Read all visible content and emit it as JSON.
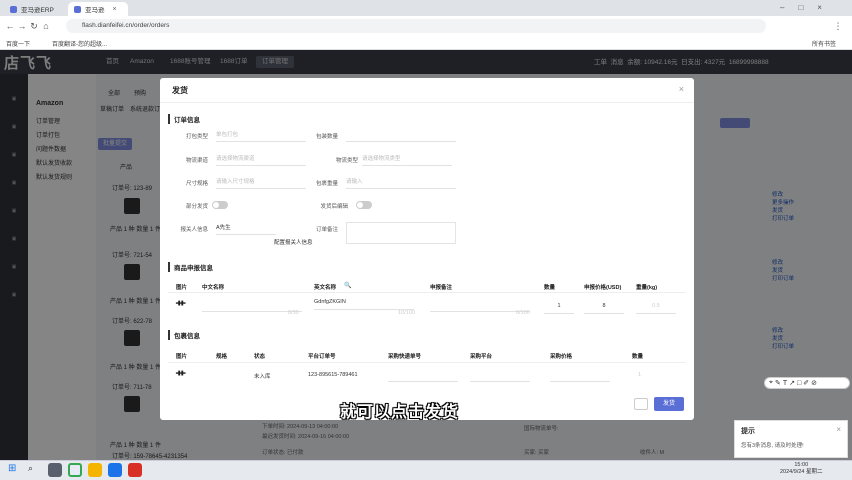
{
  "browser": {
    "tabs": [
      {
        "label": "亚马逊ERP",
        "active": false
      },
      {
        "label": "亚马逊",
        "active": true
      }
    ],
    "url": "flash.dianfeifei.cn/order/orders",
    "bookmarks": [
      "百度一下",
      "百度翻译-您的超级..."
    ],
    "bookmarks_right": "所有书签"
  },
  "app": {
    "logo": "店飞飞",
    "topnav": [
      "首页",
      "Amazon",
      "1688账号管理",
      "1688订单",
      "订单管理"
    ],
    "topnav_active": "订单管理",
    "right_info": {
      "work": "工单",
      "messages": "消息",
      "balance": "余额: 10942.16元",
      "cost": "日支出: 4327元",
      "phone": "16899998888"
    },
    "sidebar_heading": "Amazon",
    "sidebar_items": [
      "订单管理",
      "订单打包",
      "问题件数据",
      "默认发货收款",
      "默认发货规则"
    ]
  },
  "background": {
    "tabs": [
      "全部",
      "预购"
    ],
    "filters": [
      "草稿订单",
      "系统退款订单"
    ],
    "buttons": [
      "批量提交"
    ],
    "label_product": "产品",
    "orders": [
      {
        "no": "订单号: 123-89",
        "line": "产品 1 种  数量 1 件"
      },
      {
        "no": "订单号: 721-54",
        "line": "产品 1 种  数量 1 件"
      },
      {
        "no": "订单号: 622-78",
        "line": "产品 1 种  数量 1 件"
      },
      {
        "no": "订单号: 711-78",
        "line": "产品 1 种  数量 1 件"
      },
      {
        "no": "订单号: 159-78645-4231354",
        "line": ""
      }
    ],
    "row_actions": [
      "修改",
      "更多操作",
      "发货",
      "打印订单"
    ],
    "bottom": {
      "order_time": "下单时间: 2024-09-13 04:00:00",
      "latest_ship": "最迟发货时间: 2024-09-16 04:00:00",
      "order_status": "订单状态: 已付款",
      "buyer": "买家: 买家",
      "tracking": "国际物流单号:",
      "address": "收件人: M"
    }
  },
  "modal": {
    "title": "发货",
    "sections": {
      "order_info": "订单信息",
      "product_info": "商品申报信息",
      "package_info": "包裹信息"
    },
    "fields": [
      {
        "label": "打包类型",
        "value": "单包打包"
      },
      {
        "label": "包装数量",
        "value": ""
      },
      {
        "label": "物流渠道",
        "value": "请选择物流渠道"
      },
      {
        "label": "物流类型",
        "value": "请选择物流类型"
      },
      {
        "label": "尺寸规格",
        "value": "请输入尺寸规格"
      },
      {
        "label": "包裹重量",
        "value": "请输入"
      },
      {
        "label": "部分发货",
        "value": ""
      },
      {
        "label": "发货后编辑",
        "value": ""
      },
      {
        "label": "报关人信息",
        "value": "A先生"
      },
      {
        "label": "订单备注",
        "value": ""
      }
    ],
    "config_link": "配置报关人信息",
    "product_table": {
      "headers": [
        "图片",
        "中文名称",
        "英文名称",
        "申报备注",
        "数量",
        "申报价格(USD)",
        "重量(kg)"
      ],
      "row": {
        "cn_name": "",
        "cn_count": "0/30",
        "en_name": "GdnfgZKGIN",
        "en_count": "10/100",
        "remark_count": "0/100",
        "qty": "1",
        "price": "8",
        "weight": "0.5"
      }
    },
    "package_table": {
      "headers": [
        "图片",
        "规格",
        "状态",
        "平台订单号",
        "采购快递单号",
        "采购平台",
        "采购价格",
        "数量"
      ],
      "row": {
        "spec": "",
        "status": "未入库",
        "platform_order": "123-895615-789461",
        "tracking": "",
        "platform": "",
        "price": "",
        "qty": "1"
      }
    },
    "buttons": {
      "cancel": "",
      "ship": "发货"
    }
  },
  "caption": "就可以点击发货",
  "notification": {
    "title": "提示",
    "body": "您有3条消息, 请及时处理!"
  },
  "taskbar": {
    "time": "15:00",
    "date": "2024/9/24 星期二"
  },
  "colors": {
    "accent": "#5a6fd6",
    "header": "#3b3f4a",
    "rail": "#2f323b"
  }
}
